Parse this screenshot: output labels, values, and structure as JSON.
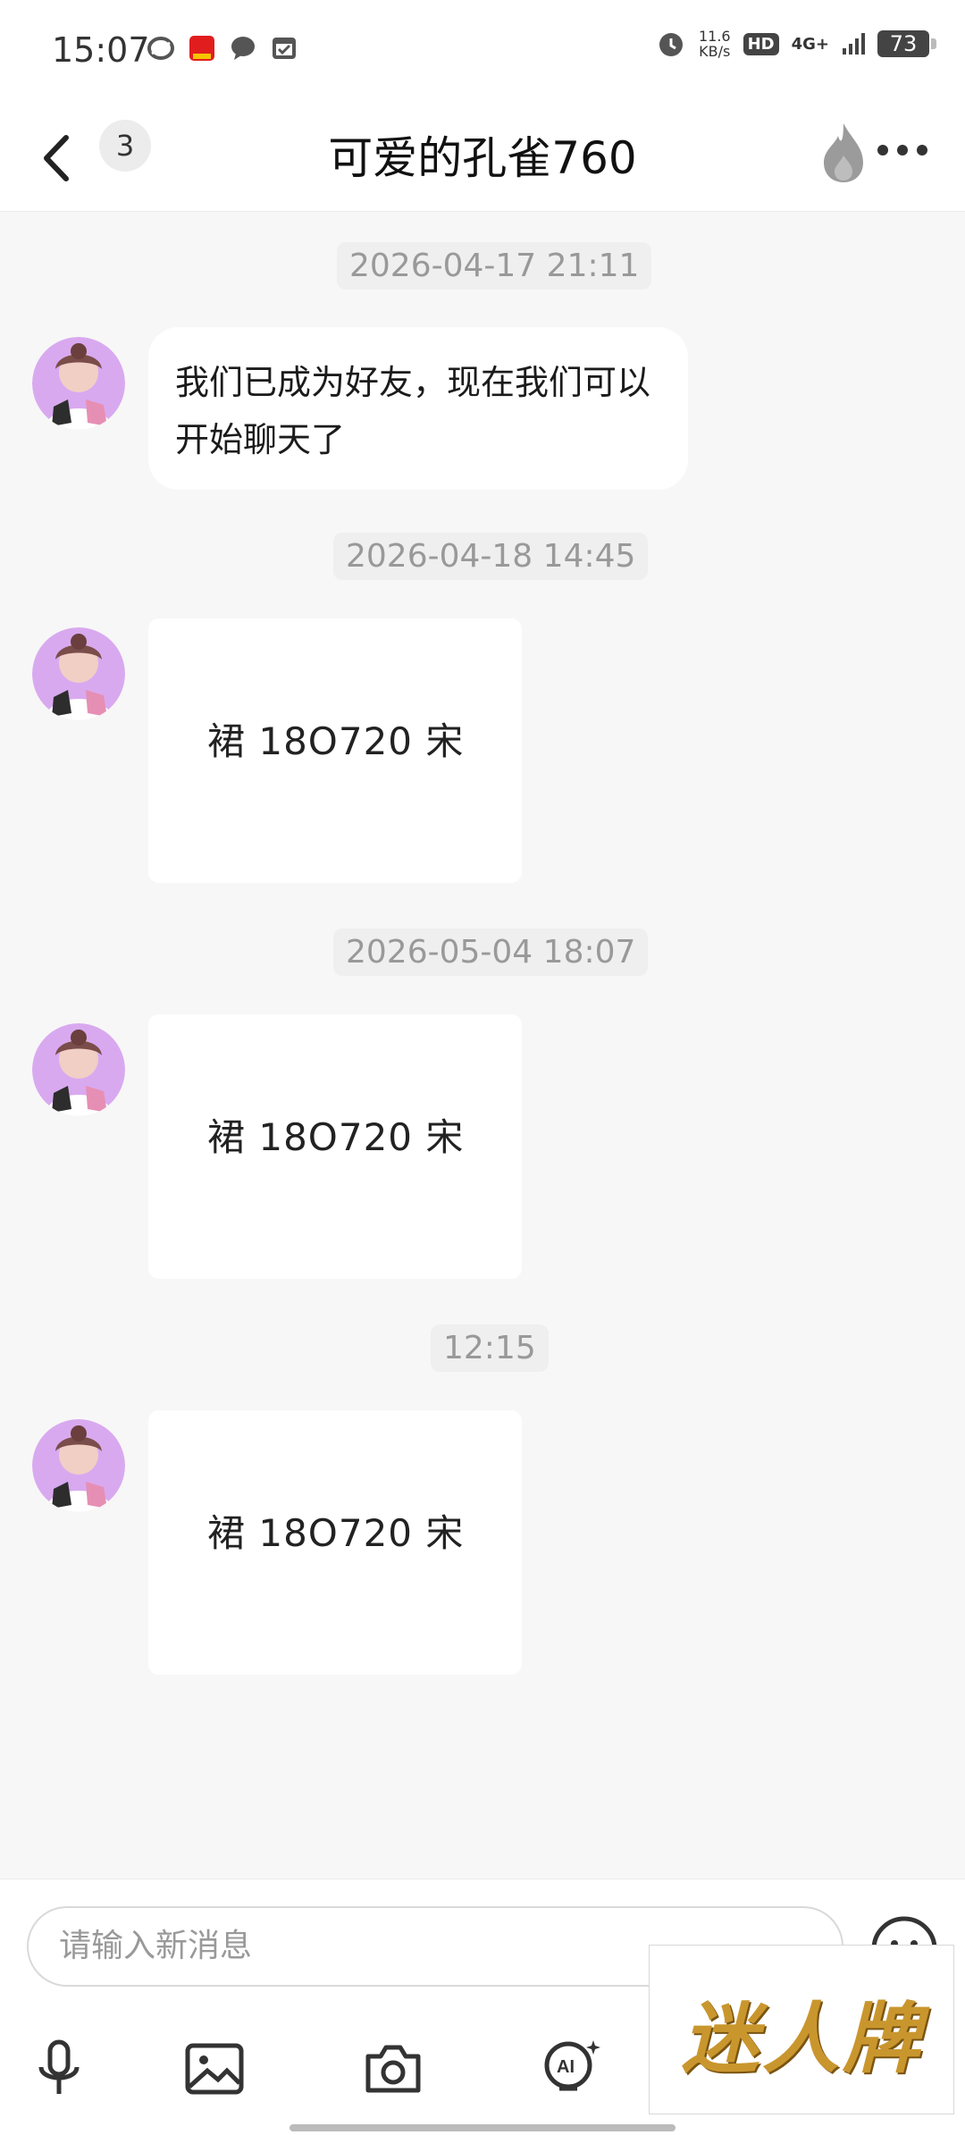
{
  "status": {
    "time": "15:07",
    "netspeed_value": "11.6",
    "netspeed_unit": "KB/s",
    "hd": "HD",
    "network": "4G+",
    "battery": "73"
  },
  "header": {
    "unread_count": "3",
    "title": "可爱的孔雀760"
  },
  "messages": {
    "ts1": "2026-04-17 21:11",
    "text1": "我们已成为好友，现在我们可以开始聊天了",
    "ts2": "2026-04-18 14:45",
    "card2": "裙 18O720 宋",
    "ts3": "2026-05-04 18:07",
    "card3": "裙 18O720 宋",
    "ts4": "12:15",
    "card4": "裙 18O720 宋"
  },
  "composer": {
    "placeholder": "请输入新消息"
  },
  "ad": {
    "text": "迷人牌"
  }
}
